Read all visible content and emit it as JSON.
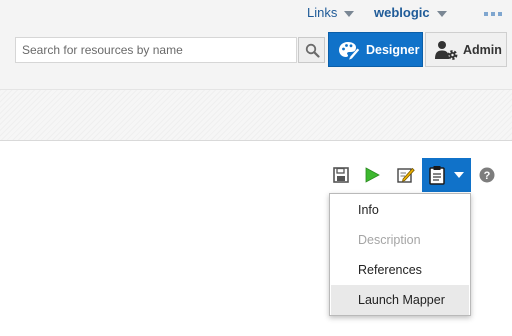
{
  "topbar": {
    "links_label": "Links",
    "user_label": "weblogic"
  },
  "search": {
    "placeholder": "Search for resources by name",
    "value": ""
  },
  "buttons": {
    "designer_label": "Designer",
    "admin_label": "Admin"
  },
  "toolbar": {
    "icons": [
      "save-icon",
      "run-icon",
      "edit-icon",
      "clipboard-icon",
      "help-icon"
    ]
  },
  "menu": {
    "items": [
      {
        "label": "Info",
        "enabled": true
      },
      {
        "label": "Description",
        "enabled": false
      },
      {
        "label": "References",
        "enabled": true
      },
      {
        "label": "Launch Mapper",
        "enabled": true,
        "highlighted": true
      }
    ]
  },
  "colors": {
    "accent": "#1072c9",
    "link": "#1f5b98",
    "run_green": "#3db82f",
    "disabled_text": "#a5a5a5"
  }
}
